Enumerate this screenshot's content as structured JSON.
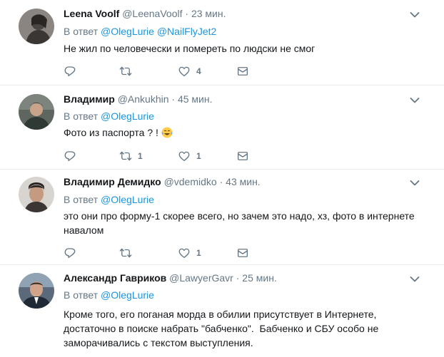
{
  "tweets": [
    {
      "name": "Leena Voolf",
      "handle": "@LeenaVoolf",
      "dot": "·",
      "time": "23 мин.",
      "reply_prefix": "В ответ",
      "mentions": [
        "@OlegLurie",
        "@NailFlyJet2"
      ],
      "text": "Не жил по человечески и помереть по людски не смог",
      "retweets": "",
      "likes": "4"
    },
    {
      "name": "Владимир",
      "handle": "@Ankukhin",
      "dot": "·",
      "time": "45 мин.",
      "reply_prefix": "В ответ",
      "mentions": [
        "@OlegLurie"
      ],
      "text": "Фото из паспорта ? !",
      "emoji": "face-with-tears-of-joy",
      "retweets": "1",
      "likes": "1"
    },
    {
      "name": "Владимир Демидко",
      "handle": "@vdemidko",
      "dot": "·",
      "time": "43 мин.",
      "reply_prefix": "В ответ",
      "mentions": [
        "@OlegLurie"
      ],
      "text_lines": [
        "это они про форму-1 скорее всего, но зачем это надо, хз, фото в интернете",
        "навалом"
      ],
      "retweets": "",
      "likes": "1"
    },
    {
      "name": "Александр Гавриков",
      "handle": "@LawyerGavr",
      "dot": "·",
      "time": "25 мин.",
      "reply_prefix": "В ответ",
      "mentions": [
        "@OlegLurie"
      ],
      "text_lines": [
        "Кроме того, его поганая морда в обилии присутствует в Интернете,",
        "достаточно в поиске набрать \"бабченко\".  Бабченко и СБУ особо не",
        "заморачивались с текстом выступления."
      ]
    }
  ],
  "icons": {
    "reply": "reply-icon",
    "retweet": "retweet-icon",
    "like": "heart-icon",
    "dm": "envelope-icon",
    "menu": "chevron-down-icon"
  },
  "colors": {
    "link": "#1b95e0",
    "secondary": "#657786",
    "divider": "#e6ecf0"
  }
}
